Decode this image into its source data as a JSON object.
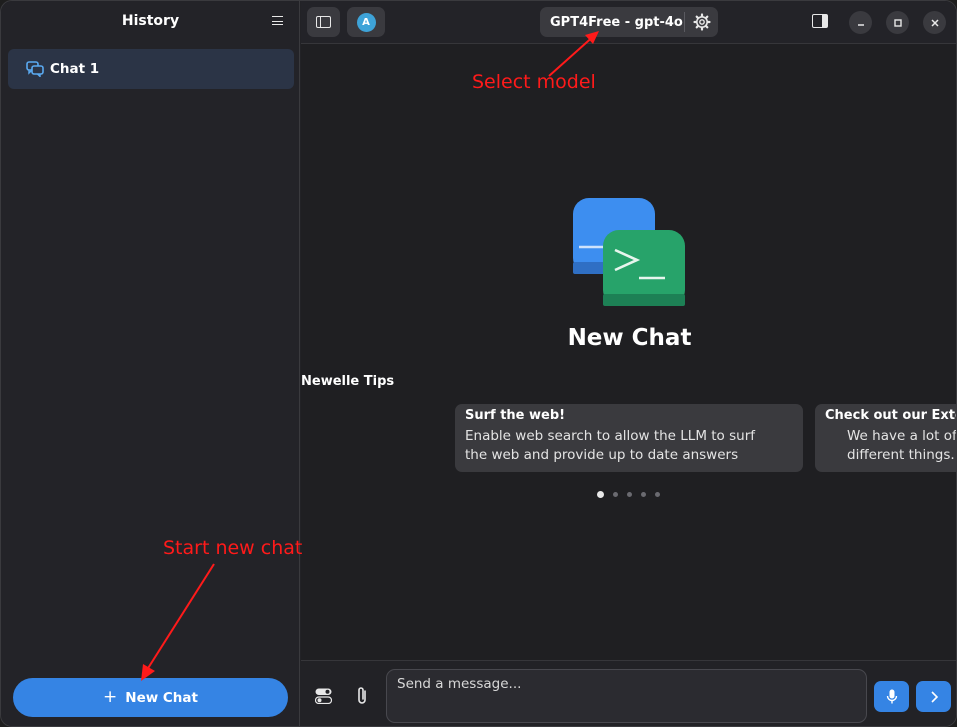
{
  "sidebar": {
    "title": "History",
    "menu_icon": "hamburger-menu-icon",
    "chats": [
      {
        "label": "Chat 1",
        "icon": "chat-bubbles-icon",
        "selected": true
      }
    ],
    "new_chat_label": "New Chat",
    "new_chat_icon": "plus-icon"
  },
  "header": {
    "model_label": "GPT4Free - gpt-4o",
    "avatar_letter": "A",
    "icons": [
      "sidebar-toggle-icon",
      "avatar-icon",
      "gear-icon",
      "right-pane-icon",
      "minimize-icon",
      "maximize-icon",
      "close-icon"
    ]
  },
  "annotations": {
    "select_model": "Select model",
    "start_new_chat": "Start new chat",
    "color": "#ff1a1a"
  },
  "main": {
    "title": "New Chat",
    "tips_heading": "Newelle Tips",
    "tips": [
      {
        "title": "Surf the web!",
        "body_line1": "Enable web search to allow the LLM to surf",
        "body_line2": "the web and provide up to date answers"
      },
      {
        "title": "Check out our Exter",
        "body_line1": "We have a lot of",
        "body_line2": "different things."
      }
    ],
    "carousel_pages": 5,
    "carousel_active_index": 0
  },
  "input": {
    "placeholder": "Send a message...",
    "send_icon": "chevron-right-icon",
    "mic_icon": "microphone-icon",
    "attach_icon": "paperclip-icon",
    "tools_icon": "toggles-icon"
  },
  "colors": {
    "accent": "#3584e4",
    "sidebar_bg": "#232328",
    "selected_chat_bg": "#2b3446",
    "main_bg": "#1f1f22",
    "logo_blue": "#3d8ef0",
    "logo_green": "#27a36a"
  }
}
